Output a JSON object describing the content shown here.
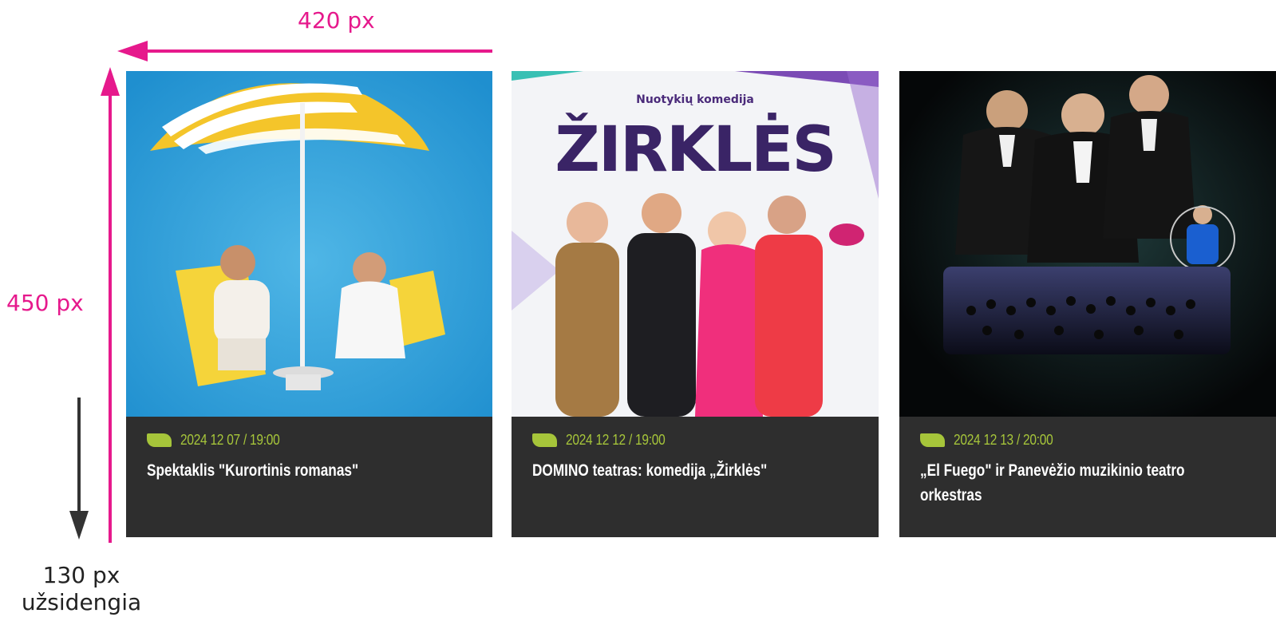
{
  "annotations": {
    "width_label": "420 px",
    "height_label": "450 px",
    "cover_label_line1": "130 px",
    "cover_label_line2": "užsidengia",
    "accent_color": "#e6198c",
    "cover_arrow_color": "#333333"
  },
  "theme": {
    "card_bg": "#2e2e2e",
    "date_color": "#a6c53a",
    "title_color": "#ffffff"
  },
  "cards": [
    {
      "date": "2024 12 07 / 19:00",
      "title": "Spektaklis \"Kurortinis romanas\"",
      "image": "beach-umbrella-poster"
    },
    {
      "date": "2024 12 12 / 19:00",
      "title": "DOMINO teatras: komedija „Žirklės\"",
      "image": "zirkles-comedy-poster",
      "poster_subtitle": "Nuotykių komedija",
      "poster_title": "ŽIRKLĖS"
    },
    {
      "date": "2024 12 13 / 20:00",
      "title": "„El Fuego\" ir Panevėžio muzikinio teatro orkestras",
      "image": "concert-orchestra-poster"
    }
  ]
}
